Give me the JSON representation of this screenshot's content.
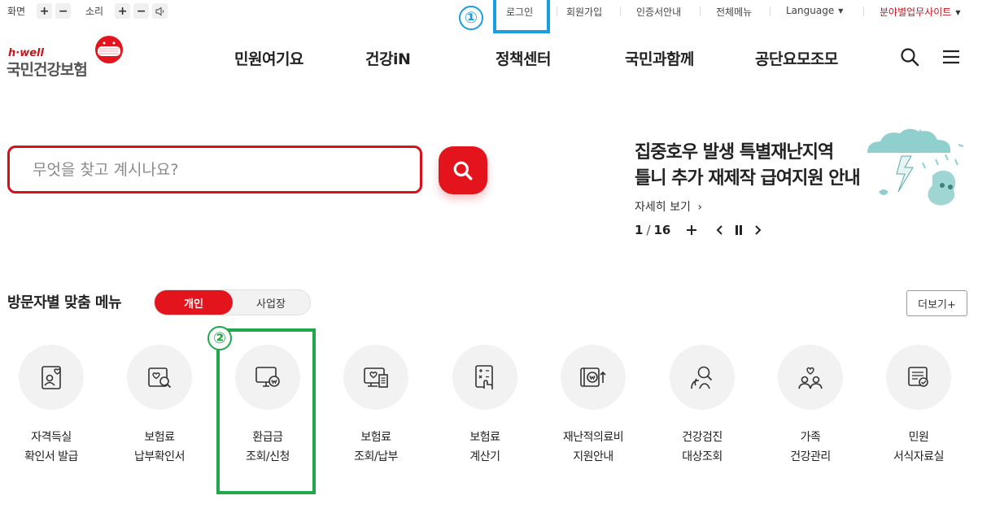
{
  "utility": {
    "screen_label": "화면",
    "sound_label": "소리",
    "plus": "+",
    "minus": "−",
    "links": [
      "로그인",
      "회원가입",
      "인증서안내",
      "전체메뉴",
      "Language",
      "분야별업무사이트"
    ]
  },
  "annotations": {
    "one": "①",
    "two": "②"
  },
  "logo": {
    "sub": "h·well",
    "name": "국민건강보험"
  },
  "gnb": [
    "민원여기요",
    "건강iN",
    "정책센터",
    "국민과함께",
    "공단요모조모"
  ],
  "search": {
    "placeholder": "무엇을 찾고 계시나요?"
  },
  "banner": {
    "title_line1": "집중호우 발생 특별재난지역",
    "title_line2": "틀니 추가 재제작 급여지원 안내",
    "more": "자세히 보기",
    "current": "1",
    "total": "16"
  },
  "visitor_menu": {
    "title": "방문자별 맞춤 메뉴",
    "tabs": [
      "개인",
      "사업장"
    ],
    "more": "더보기+",
    "items": [
      {
        "line1": "자격득실",
        "line2": "확인서 발급",
        "icon": "id-card-icon"
      },
      {
        "line1": "보험료",
        "line2": "납부확인서",
        "icon": "document-search-icon"
      },
      {
        "line1": "환급금",
        "line2": "조회/신청",
        "icon": "monitor-won-icon"
      },
      {
        "line1": "보험료",
        "line2": "조회/납부",
        "icon": "monitor-receipt-icon"
      },
      {
        "line1": "보험료",
        "line2": "계산기",
        "icon": "calculator-icon"
      },
      {
        "line1": "재난적의료비",
        "line2": "지원안내",
        "icon": "won-support-icon"
      },
      {
        "line1": "건강검진",
        "line2": "대상조회",
        "icon": "person-search-icon"
      },
      {
        "line1": "가족",
        "line2": "건강관리",
        "icon": "family-icon"
      },
      {
        "line1": "민원",
        "line2": "서식자료실",
        "icon": "form-document-icon"
      }
    ]
  },
  "colors": {
    "brand_red": "#e4141c",
    "annotation_blue": "#1a9ee2",
    "annotation_green": "#22a84a"
  }
}
